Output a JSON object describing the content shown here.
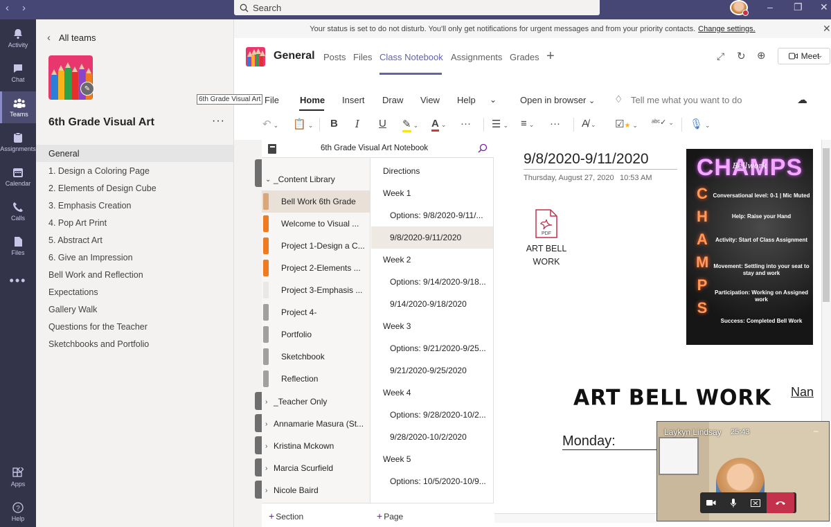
{
  "top_bar": {
    "search_placeholder": "Search"
  },
  "app_rail": {
    "items": [
      {
        "label": "Activity",
        "icon": "bell-icon"
      },
      {
        "label": "Chat",
        "icon": "chat-icon"
      },
      {
        "label": "Teams",
        "icon": "teams-icon",
        "active": true
      },
      {
        "label": "Assignments",
        "icon": "assignments-icon"
      },
      {
        "label": "Calendar",
        "icon": "calendar-icon"
      },
      {
        "label": "Calls",
        "icon": "phone-icon"
      },
      {
        "label": "Files",
        "icon": "file-icon"
      },
      {
        "label": "Apps",
        "icon": "apps-icon"
      },
      {
        "label": "Help",
        "icon": "help-icon"
      }
    ]
  },
  "team_panel": {
    "back_label": "All teams",
    "team_name": "6th Grade Visual Art",
    "tooltip": "6th Grade Visual Art",
    "channels": [
      "General",
      "1. Design a Coloring Page",
      "2. Elements of Design Cube",
      "3. Emphasis Creation",
      "4. Pop Art Print",
      "5. Abstract Art",
      "6. Give an Impression",
      "Bell Work and Reflection",
      "Expectations",
      "Gallery Walk",
      "Questions for the Teacher",
      "Sketchbooks and Portfolio"
    ]
  },
  "banner": {
    "message": "Your status is set to do not disturb. You'll only get notifications for urgent messages and from your priority contacts.",
    "link": "Change settings."
  },
  "channel_header": {
    "title": "General",
    "tabs": [
      "Posts",
      "Files",
      "Class Notebook",
      "Assignments",
      "Grades"
    ],
    "active_tab": "Class Notebook",
    "meet_label": "Meet"
  },
  "ribbon": {
    "tabs": [
      "File",
      "Home",
      "Insert",
      "Draw",
      "View",
      "Help"
    ],
    "active_tab": "Home",
    "open_in_browser": "Open in browser",
    "tell_me": "Tell me what you want to do"
  },
  "notebook": {
    "name": "6th Grade Visual Art Notebook",
    "sections": [
      {
        "label": "_Content Library",
        "group": true,
        "expanded": true
      },
      {
        "label": "Bell Work 6th Grade",
        "color": "#d9a77a",
        "active": true
      },
      {
        "label": "Welcome to Visual ...",
        "color": "#f07a1f"
      },
      {
        "label": "Project 1-Design a C...",
        "color": "#f07a1f"
      },
      {
        "label": "Project 2-Elements ...",
        "color": "#f07a1f"
      },
      {
        "label": "Project 3-Emphasis ...",
        "color": "#e8e8e8"
      },
      {
        "label": "Project 4-",
        "color": "#a0a0a0"
      },
      {
        "label": "Portfolio",
        "color": "#a0a0a0"
      },
      {
        "label": "Sketchbook",
        "color": "#a0a0a0"
      },
      {
        "label": "Reflection",
        "color": "#a0a0a0"
      },
      {
        "label": "_Teacher Only",
        "group": true
      },
      {
        "label": "Annamarie Masura (St...",
        "group": true
      },
      {
        "label": "Kristina Mckown",
        "group": true
      },
      {
        "label": "Marcia Scurfield",
        "group": true
      },
      {
        "label": "Nicole Baird",
        "group": true
      }
    ],
    "pages": [
      {
        "label": "Directions",
        "level": 0
      },
      {
        "label": "Week 1",
        "level": 0
      },
      {
        "label": "Options: 9/8/2020-9/11/...",
        "level": 1
      },
      {
        "label": "9/8/2020-9/11/2020",
        "level": 1,
        "active": true
      },
      {
        "label": "Week 2",
        "level": 0
      },
      {
        "label": "Options: 9/14/2020-9/18...",
        "level": 1
      },
      {
        "label": "9/14/2020-9/18/2020",
        "level": 1
      },
      {
        "label": "Week 3",
        "level": 0
      },
      {
        "label": "Options: 9/21/2020-9/25...",
        "level": 1
      },
      {
        "label": "9/21/2020-9/25/2020",
        "level": 1
      },
      {
        "label": "Week 4",
        "level": 0
      },
      {
        "label": "Options: 9/28/2020-10/2...",
        "level": 1
      },
      {
        "label": "9/28/2020-10/2/2020",
        "level": 1
      },
      {
        "label": "Week 5",
        "level": 0
      },
      {
        "label": "Options: 10/5/2020-10/9...",
        "level": 1
      }
    ],
    "add_section": "Section",
    "add_page": "Page"
  },
  "page": {
    "title": "9/8/2020-9/11/2020",
    "date": "Thursday, August 27, 2020",
    "time": "10:53 AM",
    "attachment": {
      "icon_text": "PDF",
      "line1": "ART BELL",
      "line2": "WORK"
    },
    "champs": {
      "heading": "CHAMPS",
      "subheading": "Bellwork",
      "vertical_letters": [
        "C",
        "H",
        "A",
        "M",
        "P",
        "S"
      ],
      "lines": [
        "Conversational level: 0-1 | Mic Muted",
        "Help: Raise your Hand",
        "Activity: Start of Class Assignment",
        "Movement: Settling into your seat to stay and work",
        "Participation: Working on Assigned work",
        "Success: Completed Bell Work"
      ]
    },
    "worksheet_title": "ART BELL WORK",
    "name_label": "Nan",
    "monday_label": "Monday:"
  },
  "video": {
    "participant": "Laykyn Lindsay",
    "duration": "25:43"
  },
  "colors": {
    "teams_purple": "#6264a7",
    "rail_bg": "#33344a",
    "topbar_bg": "#464775",
    "onenote_purple": "#7719aa",
    "hangup_red": "#c4314b"
  }
}
